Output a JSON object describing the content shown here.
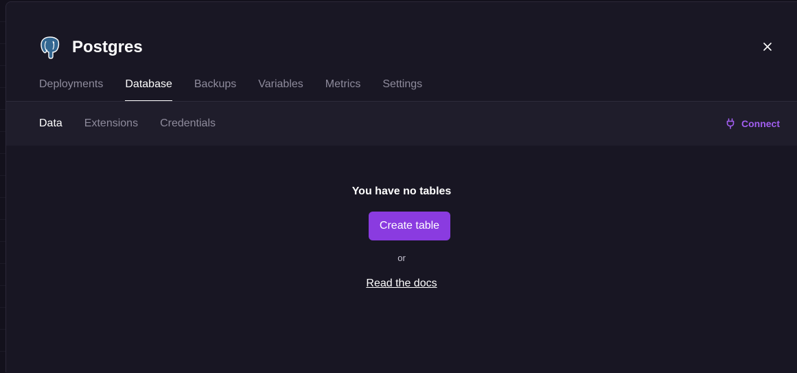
{
  "service": {
    "title": "Postgres",
    "logo_icon": "postgres-elephant-icon",
    "close_icon": "close-icon"
  },
  "tabs": [
    {
      "label": "Deployments",
      "active": false
    },
    {
      "label": "Database",
      "active": true
    },
    {
      "label": "Backups",
      "active": false
    },
    {
      "label": "Variables",
      "active": false
    },
    {
      "label": "Metrics",
      "active": false
    },
    {
      "label": "Settings",
      "active": false
    }
  ],
  "subtabs": [
    {
      "label": "Data",
      "active": true
    },
    {
      "label": "Extensions",
      "active": false
    },
    {
      "label": "Credentials",
      "active": false
    }
  ],
  "connect": {
    "label": "Connect",
    "icon": "plug-icon"
  },
  "empty_state": {
    "title": "You have no tables",
    "create_button": "Create table",
    "or_text": "or",
    "docs_link": "Read the docs"
  },
  "colors": {
    "accent": "#8a3be0",
    "connect": "#a15ef0",
    "background": "#181623"
  }
}
